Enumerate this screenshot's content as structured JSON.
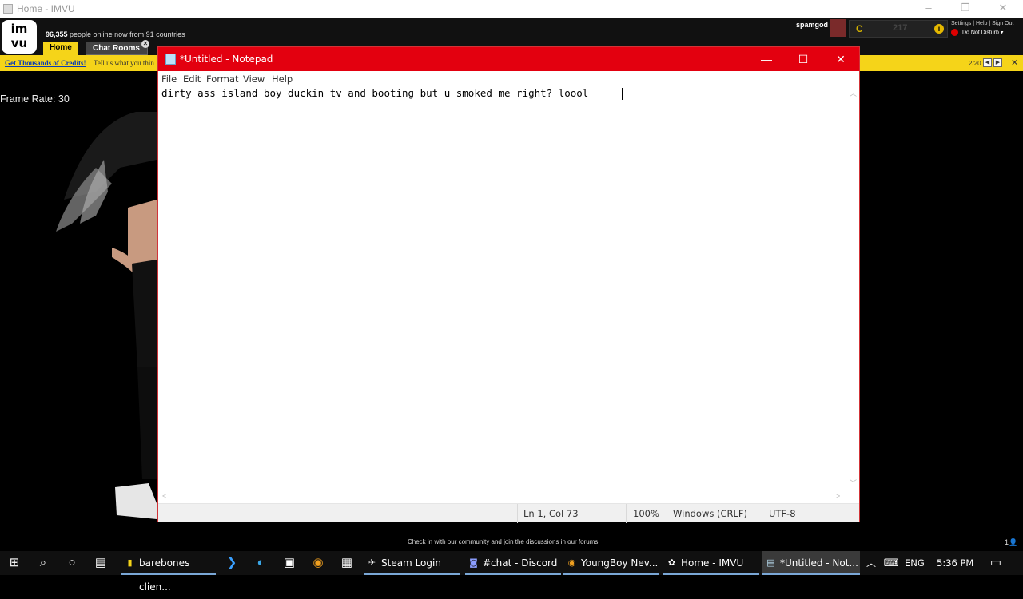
{
  "imvu_window": {
    "title": "Home - IMVU",
    "online_count": "96,355",
    "online_suffix": " people online now from 91 countries",
    "tabs": [
      "Home",
      "Chat Rooms"
    ],
    "username": "spamgod",
    "credits_icon": "C",
    "credits_count": "217",
    "top_links": "Settings | Help | Sign Out",
    "status": "Do Not Disturb ▾",
    "banner_link": "Get Thousands of Credits!",
    "banner_text": " Tell us what you thin",
    "banner_counter": "2/20",
    "frame_rate": "Frame Rate: 30",
    "footer_prefix": "Check in with our ",
    "footer_link1": "community",
    "footer_mid": " and join the discussions in our ",
    "footer_link2": "forums"
  },
  "notepad": {
    "title": "*Untitled - Notepad",
    "menu": [
      "File",
      "Edit",
      "Format",
      "View",
      "Help"
    ],
    "content": "dirty ass island boy duckin tv and booting but u smoked me right? loool ",
    "status": {
      "position": "Ln 1, Col 73",
      "zoom": "100%",
      "line_endings": "Windows (CRLF)",
      "encoding": "UTF-8"
    }
  },
  "taskbar": {
    "apps": [
      {
        "label": "barebones clien...",
        "icon": "folder-icon"
      },
      {
        "label": "Steam Login",
        "icon": "steam-icon"
      },
      {
        "label": "#chat - Discord",
        "icon": "discord-icon"
      },
      {
        "label": "YoungBoy Nev...",
        "icon": "chrome-icon"
      },
      {
        "label": "Home - IMVU",
        "icon": "imvu-icon"
      },
      {
        "label": "*Untitled - Not...",
        "icon": "notepad-icon"
      }
    ],
    "language": "ENG",
    "time": "5:36 PM"
  },
  "colors": {
    "notepad_titlebar": "#e3000f",
    "imvu_yellow": "#f5d419",
    "taskbar": "#101010"
  }
}
